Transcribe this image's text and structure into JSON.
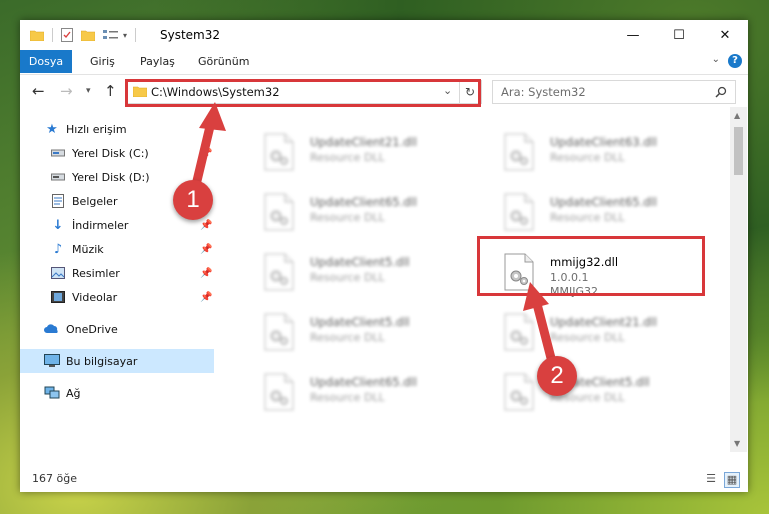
{
  "window": {
    "title": "System32",
    "controls": {
      "minimize": "—",
      "maximize": "☐",
      "close": "✕"
    }
  },
  "ribbon": {
    "tabs": [
      "Dosya",
      "Giriş",
      "Paylaş",
      "Görünüm"
    ],
    "help": "?"
  },
  "navigation": {
    "address": "C:\\Windows\\System32",
    "search_placeholder": "Ara: System32"
  },
  "sidebar": {
    "items": [
      {
        "label": "Hızlı erişim",
        "icon": "star-icon"
      },
      {
        "label": "Yerel Disk (C:)",
        "icon": "drive-icon"
      },
      {
        "label": "Yerel Disk (D:)",
        "icon": "drive-icon"
      },
      {
        "label": "Belgeler",
        "icon": "documents-icon"
      },
      {
        "label": "İndirmeler",
        "icon": "download-icon"
      },
      {
        "label": "Müzik",
        "icon": "music-icon"
      },
      {
        "label": "Resimler",
        "icon": "pictures-icon"
      },
      {
        "label": "Videolar",
        "icon": "videos-icon"
      },
      {
        "label": "OneDrive",
        "icon": "cloud-icon"
      },
      {
        "label": "Bu bilgisayar",
        "icon": "computer-icon"
      },
      {
        "label": "Ağ",
        "icon": "network-icon"
      }
    ]
  },
  "files": [
    {
      "name": "UpdateClient21.dll",
      "sub1": "Resource DLL",
      "sub2": ""
    },
    {
      "name": "UpdateClient63.dll",
      "sub1": "Resource DLL",
      "sub2": ""
    },
    {
      "name": "UpdateClient65.dll",
      "sub1": "Resource DLL",
      "sub2": ""
    },
    {
      "name": "UpdateClient65.dll",
      "sub1": "Resource DLL",
      "sub2": ""
    },
    {
      "name": "UpdateClient5.dll",
      "sub1": "Resource DLL",
      "sub2": ""
    },
    {
      "name": "mmijg32.dll",
      "sub1": "1.0.0.1",
      "sub2": "MMIJG32"
    },
    {
      "name": "UpdateClient5.dll",
      "sub1": "Resource DLL",
      "sub2": ""
    },
    {
      "name": "UpdateClient21.dll",
      "sub1": "Resource DLL",
      "sub2": ""
    },
    {
      "name": "UpdateClient65.dll",
      "sub1": "Resource DLL",
      "sub2": ""
    },
    {
      "name": "UpdateClient5.dll",
      "sub1": "Resource DLL",
      "sub2": ""
    }
  ],
  "status": {
    "item_count": "167 öğe"
  },
  "callouts": [
    "1",
    "2"
  ],
  "colors": {
    "accent": "#1979ca",
    "highlight": "#d8373a",
    "selected": "#cce8ff"
  }
}
